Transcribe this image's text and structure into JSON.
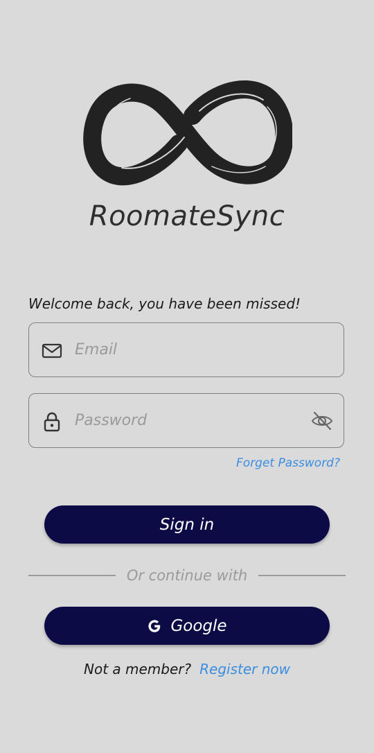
{
  "app": {
    "title": "RoomateSync"
  },
  "login": {
    "welcome": "Welcome back, you have been missed!",
    "email_placeholder": "Email",
    "password_placeholder": "Password",
    "forget_password": "Forget Password?",
    "signin_label": "Sign in",
    "divider_text": "Or continue with",
    "google_label": "Google",
    "not_member": "Not a member?",
    "register_now": "Register now"
  },
  "icons": {
    "logo": "infinity-logo",
    "email": "envelope-icon",
    "password": "lock-icon",
    "visibility": "eye-off-icon",
    "google": "google-g-icon"
  },
  "colors": {
    "background": "#dadada",
    "button": "#0d0b45",
    "link": "#3b8de0",
    "placeholder": "#9a9a9a"
  }
}
